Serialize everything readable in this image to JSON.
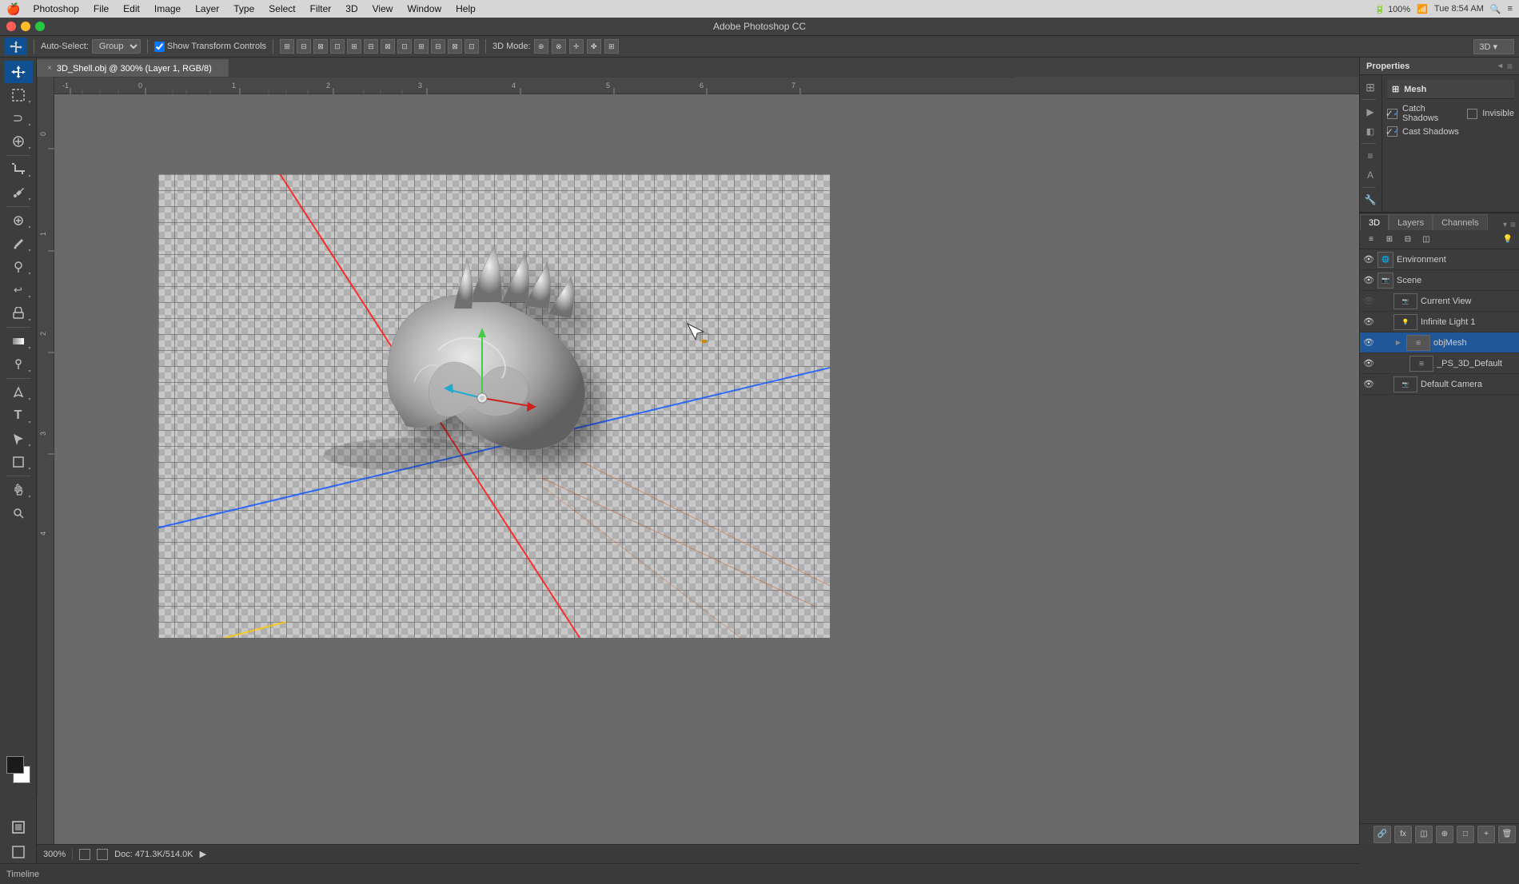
{
  "menubar": {
    "apple": "🍎",
    "items": [
      "Photoshop",
      "File",
      "Edit",
      "Image",
      "Layer",
      "Type",
      "Select",
      "Filter",
      "3D",
      "View",
      "Window",
      "Help"
    ],
    "active_item": "",
    "right": {
      "wifi": "WiFi",
      "time": "Tue 8:54 AM",
      "battery": "100%"
    }
  },
  "titlebar": {
    "title": "Adobe Photoshop CC"
  },
  "tab": {
    "name": "3D_Shell.obj @ 300% (Layer 1, RGB/8)",
    "close": "×"
  },
  "optionsbar": {
    "autoselect_label": "Auto-Select:",
    "autoselect_value": "Group",
    "show_transform": "Show Transform Controls",
    "mode_3d_label": "3D Mode:",
    "mode_3d_value": "3D",
    "transform_icons": [
      "⊞",
      "⊟",
      "⊠",
      "⊡",
      "◧",
      "◨",
      "◫",
      "⊟",
      "⊞",
      "⊡",
      "⊠",
      "⊟"
    ]
  },
  "toolbox": {
    "tools": [
      {
        "name": "move-tool",
        "icon": "✥",
        "active": true
      },
      {
        "name": "marquee-tool",
        "icon": "⬚"
      },
      {
        "name": "lasso-tool",
        "icon": "⊃"
      },
      {
        "name": "crop-tool",
        "icon": "⌸"
      },
      {
        "name": "eyedropper-tool",
        "icon": "⊘"
      },
      {
        "name": "spot-heal-tool",
        "icon": "⊕"
      },
      {
        "name": "brush-tool",
        "icon": "✏"
      },
      {
        "name": "stamp-tool",
        "icon": "⊞"
      },
      {
        "name": "history-tool",
        "icon": "↩"
      },
      {
        "name": "eraser-tool",
        "icon": "◻"
      },
      {
        "name": "gradient-tool",
        "icon": "◫"
      },
      {
        "name": "dodge-tool",
        "icon": "◑"
      },
      {
        "name": "pen-tool",
        "icon": "⊘"
      },
      {
        "name": "text-tool",
        "icon": "T"
      },
      {
        "name": "path-select-tool",
        "icon": "▶"
      },
      {
        "name": "shape-tool",
        "icon": "□"
      },
      {
        "name": "hand-tool",
        "icon": "✋"
      },
      {
        "name": "zoom-tool",
        "icon": "🔍"
      }
    ],
    "foreground_color": "#1a1a1a",
    "background_color": "#ffffff"
  },
  "statusbar": {
    "zoom": "300%",
    "doc_size": "Doc: 471.3K/514.0K",
    "arrow": "▶"
  },
  "timeline": {
    "label": "Timeline"
  },
  "properties_panel": {
    "title": "Properties",
    "close": "≡",
    "sections": [
      {
        "name": "mesh-section",
        "icon": "⊞",
        "label": "Mesh"
      }
    ],
    "catch_shadows": {
      "checked": true,
      "label": "Catch Shadows"
    },
    "invisible": {
      "checked": false,
      "label": "Invisible"
    },
    "cast_shadows": {
      "checked": true,
      "label": "Cast Shadows"
    }
  },
  "layers_panel": {
    "tabs": [
      {
        "name": "tab-3d",
        "label": "3D",
        "active": true
      },
      {
        "name": "tab-layers",
        "label": "Layers"
      },
      {
        "name": "tab-channels",
        "label": "Channels"
      }
    ],
    "toolbar_icons": [
      "≡",
      "⊞",
      "⊟",
      "◫",
      "⊗"
    ],
    "layers": [
      {
        "name": "environment-layer",
        "label": "Environment",
        "indent": 0,
        "visible": true,
        "thumb": "🌐",
        "has_expand": true
      },
      {
        "name": "scene-layer",
        "label": "Scene",
        "indent": 0,
        "visible": true,
        "thumb": "📷",
        "has_expand": true
      },
      {
        "name": "current-view-layer",
        "label": "Current View",
        "indent": 1,
        "visible": false,
        "thumb": "📷"
      },
      {
        "name": "infinite-light-layer",
        "label": "Infinite Light 1",
        "indent": 1,
        "visible": true,
        "thumb": "💡"
      },
      {
        "name": "objmesh-layer",
        "label": "objMesh",
        "indent": 1,
        "visible": true,
        "thumb": "⊞",
        "selected": true,
        "has_expand": true
      },
      {
        "name": "ps3d-layer",
        "label": "_PS_3D_Default",
        "indent": 2,
        "visible": true,
        "thumb": "⊞"
      },
      {
        "name": "default-camera-layer",
        "label": "Default Camera",
        "indent": 1,
        "visible": true,
        "thumb": "📷"
      }
    ]
  },
  "canvas": {
    "filename": "3D_Shell.obj",
    "zoom": "300%",
    "ruler_marks": [
      "-1",
      "0",
      "1",
      "2",
      "3",
      "4",
      "5",
      "6",
      "7"
    ],
    "ruler_marks_v": [
      "0",
      "1",
      "2",
      "3",
      "4"
    ]
  },
  "right_icon_strip": {
    "icons": [
      {
        "name": "move-icon",
        "glyph": "✥"
      },
      {
        "name": "rotate-icon",
        "glyph": "↺"
      },
      {
        "name": "scale-icon",
        "glyph": "⊡"
      },
      {
        "name": "transform-icon",
        "glyph": "⊠"
      },
      {
        "name": "deform-icon",
        "glyph": "⊟"
      },
      {
        "name": "material-icon",
        "glyph": "◈"
      },
      {
        "name": "camera-icon",
        "glyph": "📷"
      },
      {
        "name": "filter-icon",
        "glyph": "≡"
      },
      {
        "name": "wrench-icon",
        "glyph": "🔧"
      }
    ]
  }
}
